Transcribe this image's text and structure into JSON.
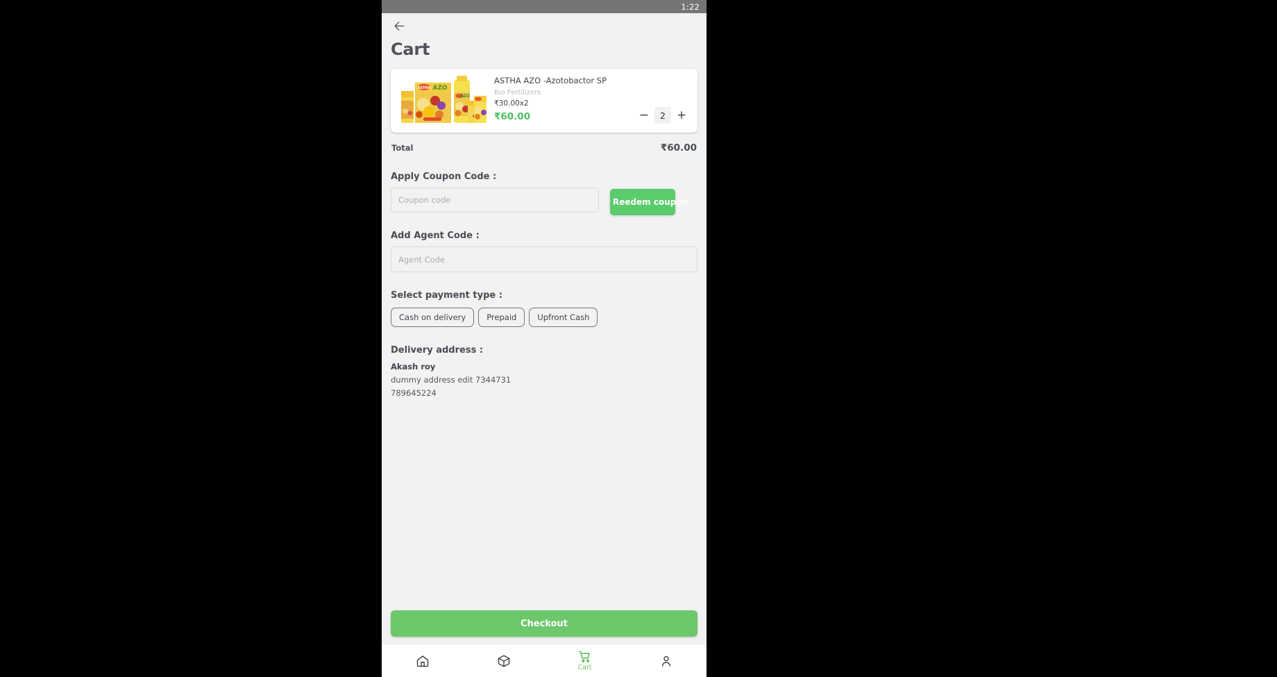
{
  "status_bar": {
    "time": "1:22"
  },
  "header": {
    "back_icon": "arrow-left-icon",
    "title": "Cart"
  },
  "cart_items": [
    {
      "name": "ASTHA AZO -Azotobactor SP",
      "category": "Bio Fertilizers",
      "unit_price_line": "₹30.00x2",
      "line_total": "₹60.00",
      "quantity": "2",
      "decrement_label": "−",
      "increment_label": "+",
      "image_alt": "astha-azo-fertilizer-bottles"
    }
  ],
  "total": {
    "label": "Total",
    "value": "₹60.00"
  },
  "coupon": {
    "heading": "Apply Coupon Code :",
    "placeholder": "Coupon code",
    "value": "",
    "button_label": "Reedem coupon"
  },
  "agent": {
    "heading": "Add Agent Code :",
    "placeholder": "Agent Code",
    "value": ""
  },
  "payment": {
    "heading": "Select payment type :",
    "options": [
      {
        "label": "Cash on delivery",
        "selected": false
      },
      {
        "label": "Prepaid",
        "selected": false
      },
      {
        "label": "Upfront Cash",
        "selected": false
      }
    ]
  },
  "address": {
    "heading": "Delivery address :",
    "name": "Akash roy",
    "line1": "dummy address edit 7344731",
    "line2": "789645224"
  },
  "checkout": {
    "label": "Checkout"
  },
  "bottom_nav": {
    "items": [
      {
        "icon": "home-icon",
        "label": "",
        "active": false
      },
      {
        "icon": "box-icon",
        "label": "",
        "active": false
      },
      {
        "icon": "cart-icon",
        "label": "Cart",
        "active": true
      },
      {
        "icon": "person-icon",
        "label": "",
        "active": false
      }
    ]
  },
  "colors": {
    "accent_green": "#6dc86c",
    "coupon_green": "#5bcb6c",
    "price_green": "#4cc065",
    "status_bar": "#757575",
    "page_bg": "#f2f2f2",
    "text_dark": "#3f434c"
  }
}
